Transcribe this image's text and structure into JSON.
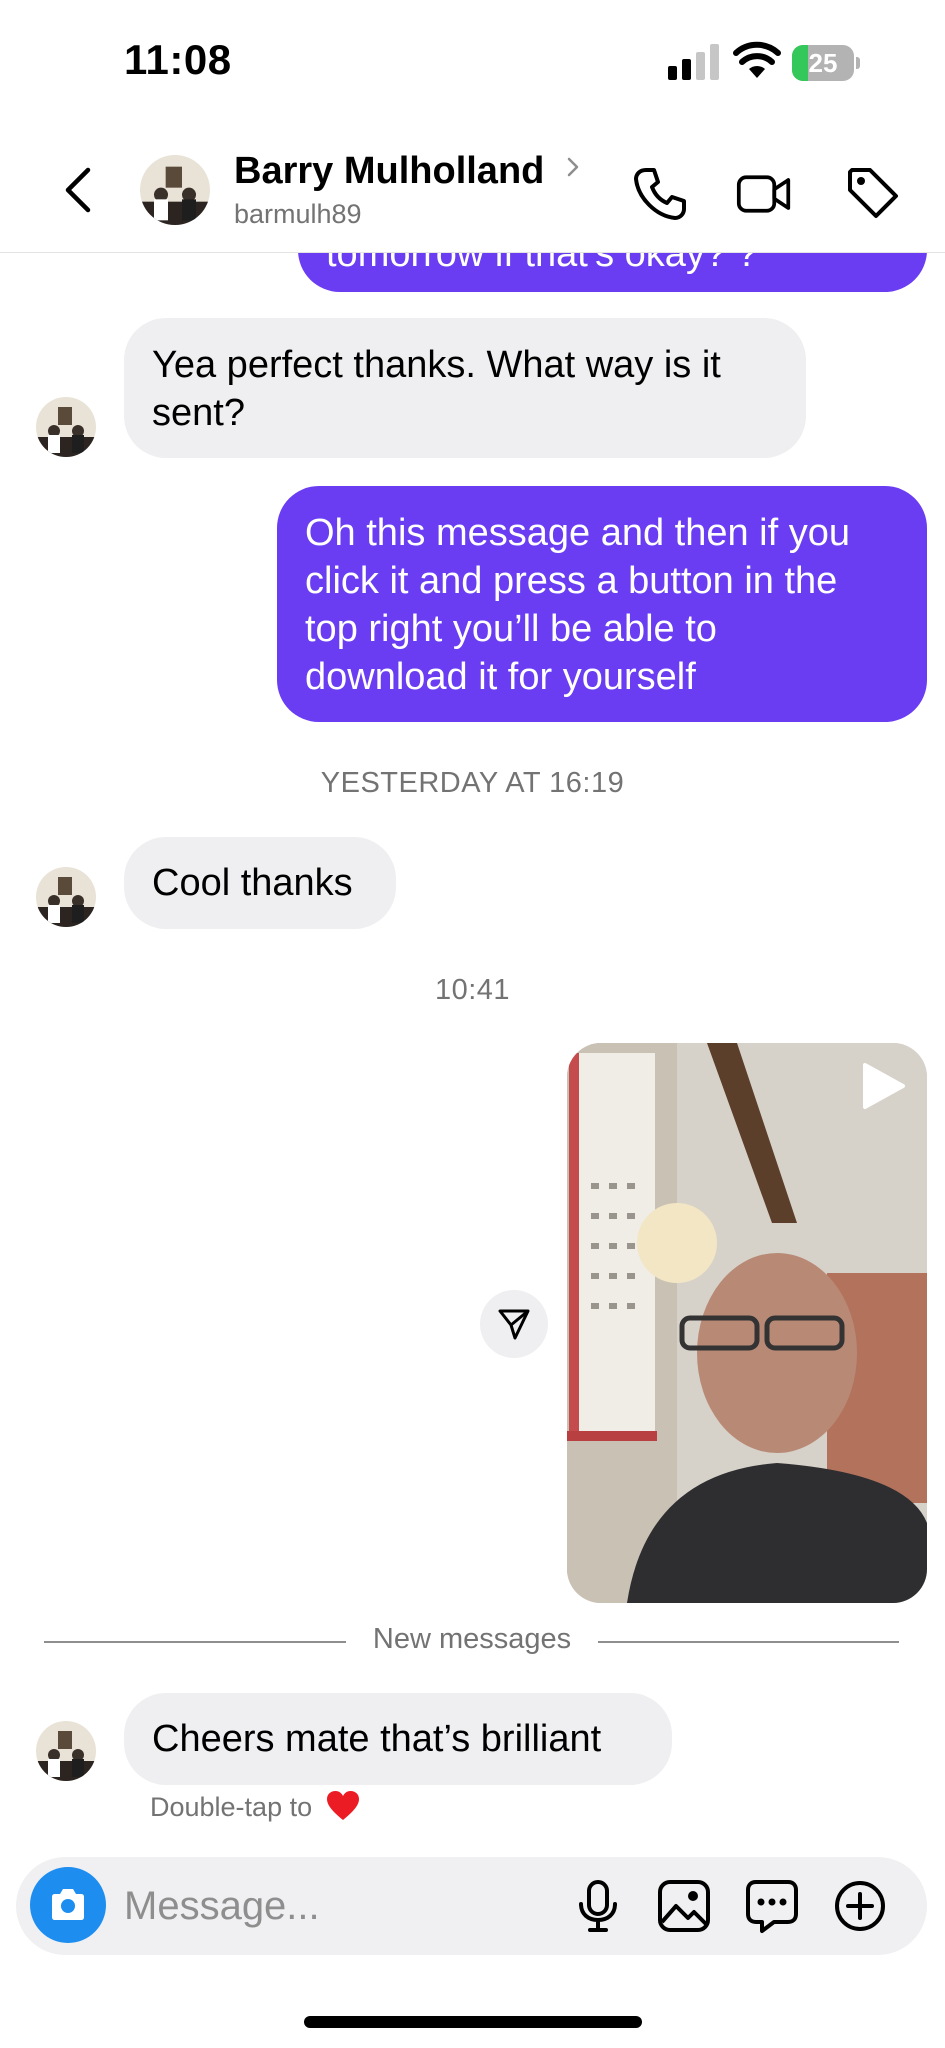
{
  "status_bar": {
    "time": "11:08",
    "battery": "25",
    "battery_level_percent": 25,
    "signal_bars_active": 2,
    "signal_bars_total": 4
  },
  "header": {
    "name": "Barry Mulholland",
    "username": "barmulh89",
    "icons": [
      "back-chevron-icon",
      "chevron-right-icon",
      "phone-icon",
      "video-camera-icon",
      "tag-icon"
    ]
  },
  "thread": {
    "partial_outgoing": "tomorrow if that's okay? ?",
    "incoming_1": [
      "Yea perfect thanks. What way is it",
      "sent?"
    ],
    "outgoing_1": [
      "Oh this message and then if you",
      "click it and press a button in the",
      "top right you’ll be able to",
      "download it for yourself"
    ],
    "timestamp_1": "YESTERDAY AT 16:19",
    "incoming_2": "Cool thanks",
    "timestamp_2": "10:41",
    "video_message": {
      "icons": [
        "play-icon",
        "share-icon"
      ]
    },
    "divider": "New messages",
    "incoming_3": "Cheers mate that’s brilliant",
    "hint": "Double-tap to"
  },
  "composer": {
    "placeholder": "Message...",
    "icons": [
      "camera-icon",
      "microphone-icon",
      "gallery-icon",
      "sticker-chat-icon",
      "plus-icon"
    ]
  },
  "colors": {
    "outgoing_bubble": "#6a3df3",
    "incoming_bubble": "#efeff1",
    "camera_button": "#1d8ef0",
    "secondary_text": "#737373"
  }
}
